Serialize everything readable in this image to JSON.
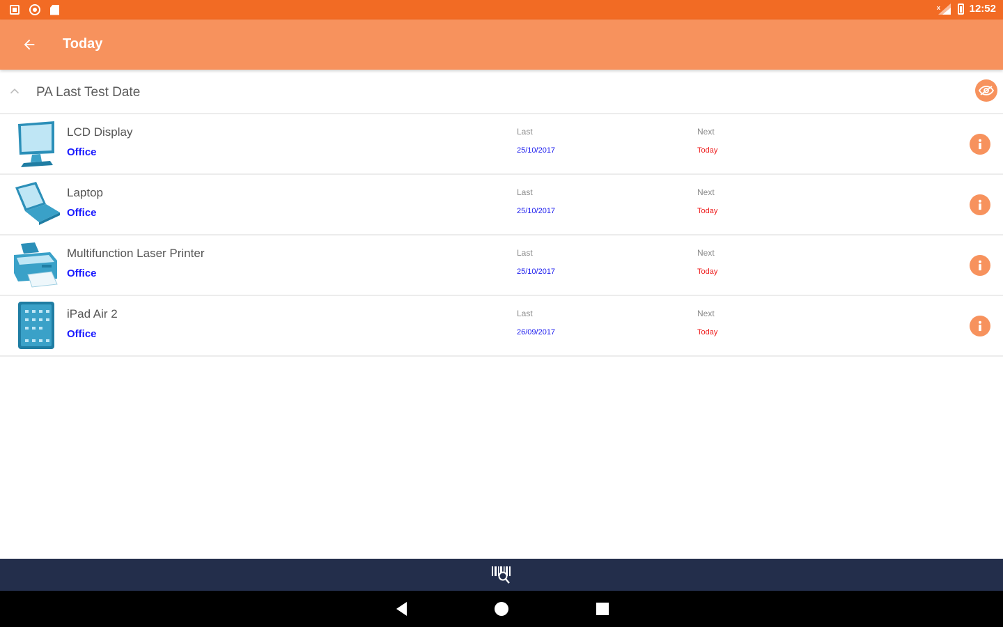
{
  "status_bar": {
    "time": "12:52",
    "left_icons": [
      "notification-square-icon",
      "notification-circle-icon",
      "sd-card-icon"
    ],
    "right_icons": [
      "signal-icon",
      "battery-icon"
    ]
  },
  "app_bar": {
    "title": "Today",
    "back_icon": "arrow-left-icon",
    "color": "#f7925d",
    "status_color": "#f26b24"
  },
  "section": {
    "title": "PA Last Test Date",
    "collapse_icon": "chevron-up-icon",
    "action_icon": "eye-off-icon"
  },
  "items": [
    {
      "name": "LCD Display",
      "location": "Office",
      "last_label": "Last",
      "last_date": "25/10/2017",
      "next_label": "Next",
      "next_date": "Today",
      "icon": "monitor-icon"
    },
    {
      "name": "Laptop",
      "location": "Office",
      "last_label": "Last",
      "last_date": "25/10/2017",
      "next_label": "Next",
      "next_date": "Today",
      "icon": "laptop-icon"
    },
    {
      "name": "Multifunction Laser Printer",
      "location": "Office",
      "last_label": "Last",
      "last_date": "25/10/2017",
      "next_label": "Next",
      "next_date": "Today",
      "icon": "printer-icon"
    },
    {
      "name": "iPad Air 2",
      "location": "Office",
      "last_label": "Last",
      "last_date": "26/09/2017",
      "next_label": "Next",
      "next_date": "Today",
      "icon": "tablet-icon"
    }
  ],
  "colors": {
    "accent": "#f7925d",
    "location_text": "#1a1aff",
    "last_date_text": "#1a1aee",
    "next_date_text": "#ee1b1b",
    "toolbar": "#232e4b"
  },
  "bottom_toolbar": {
    "icon": "barcode-scan-icon"
  },
  "nav_bar": {
    "icons": [
      "nav-back-icon",
      "nav-home-icon",
      "nav-recents-icon"
    ]
  }
}
